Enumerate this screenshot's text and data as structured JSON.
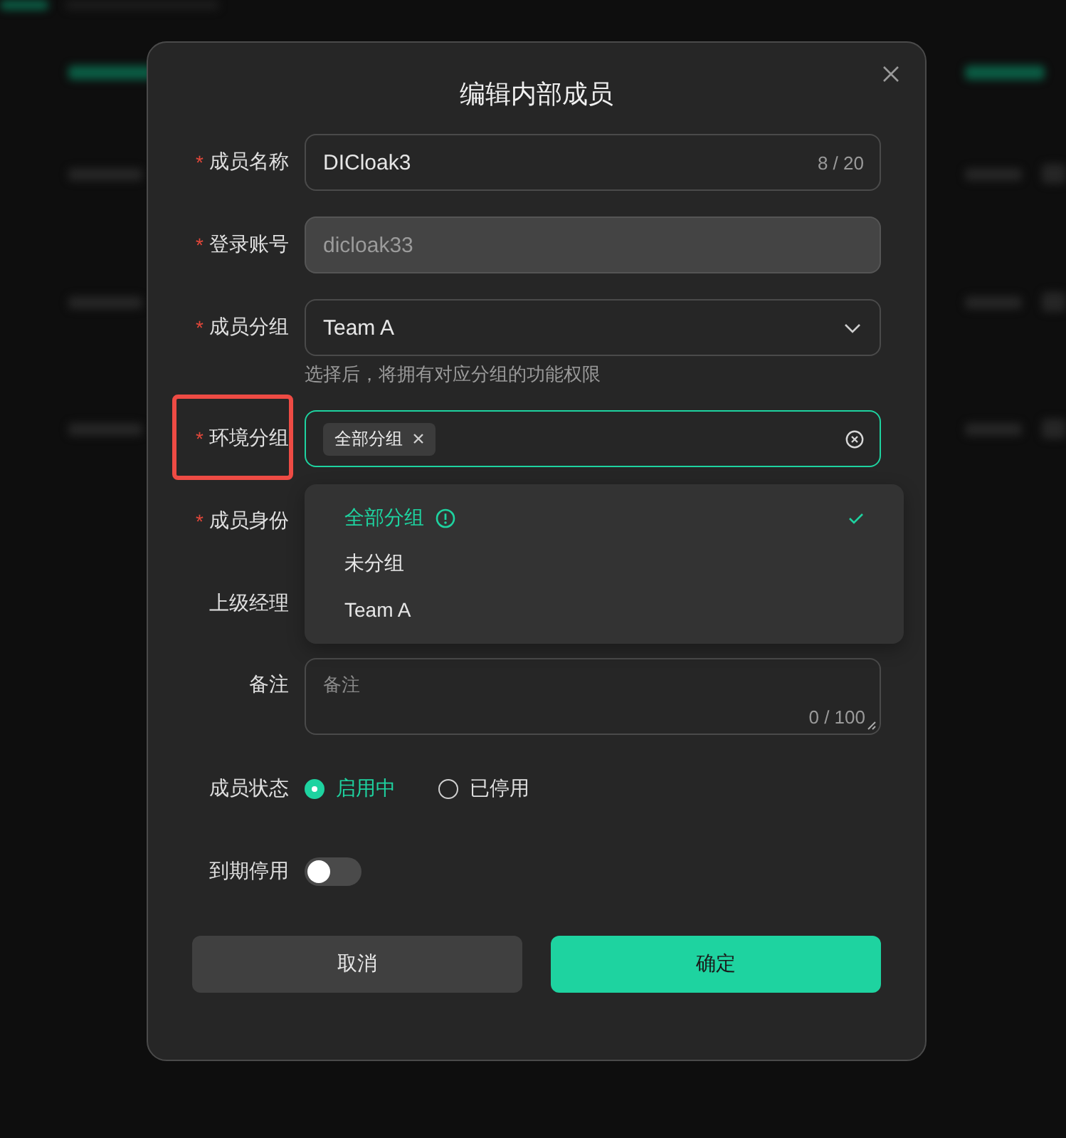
{
  "dialog": {
    "title": "编辑内部成员"
  },
  "fields": [
    {
      "kind": "text",
      "label": "成员名称",
      "required": "*",
      "value": "DICloak3",
      "counter": "8 / 20",
      "disabled": false
    },
    {
      "kind": "text",
      "label": "登录账号",
      "required": "*",
      "value": "dicloak33",
      "disabled": true
    },
    {
      "kind": "select",
      "label": "成员分组",
      "required": "*",
      "value": "Team A",
      "hint": "选择后，将拥有对应分组的功能权限"
    },
    {
      "kind": "tags",
      "label": "环境分组",
      "required": "*",
      "tags": [
        "全部分组"
      ],
      "focused": true,
      "highlighted": true,
      "dropdown": [
        {
          "label": "全部分组",
          "selected": true,
          "info": true
        },
        {
          "label": "未分组",
          "selected": false,
          "info": false
        },
        {
          "label": "Team A",
          "selected": false,
          "info": false
        }
      ]
    },
    {
      "kind": "covered",
      "label": "成员身份",
      "required": "*"
    },
    {
      "kind": "covered",
      "label": "上级经理"
    },
    {
      "kind": "textarea",
      "label": "备注",
      "placeholder": "备注",
      "counter": "0 / 100"
    },
    {
      "kind": "radio",
      "label": "成员状态",
      "options": [
        {
          "label": "启用中",
          "selected": true
        },
        {
          "label": "已停用",
          "selected": false
        }
      ]
    },
    {
      "kind": "switch",
      "label": "到期停用",
      "on": false
    }
  ],
  "buttons": [
    {
      "label": "取消",
      "kind": "secondary"
    },
    {
      "label": "确定",
      "kind": "primary"
    }
  ]
}
